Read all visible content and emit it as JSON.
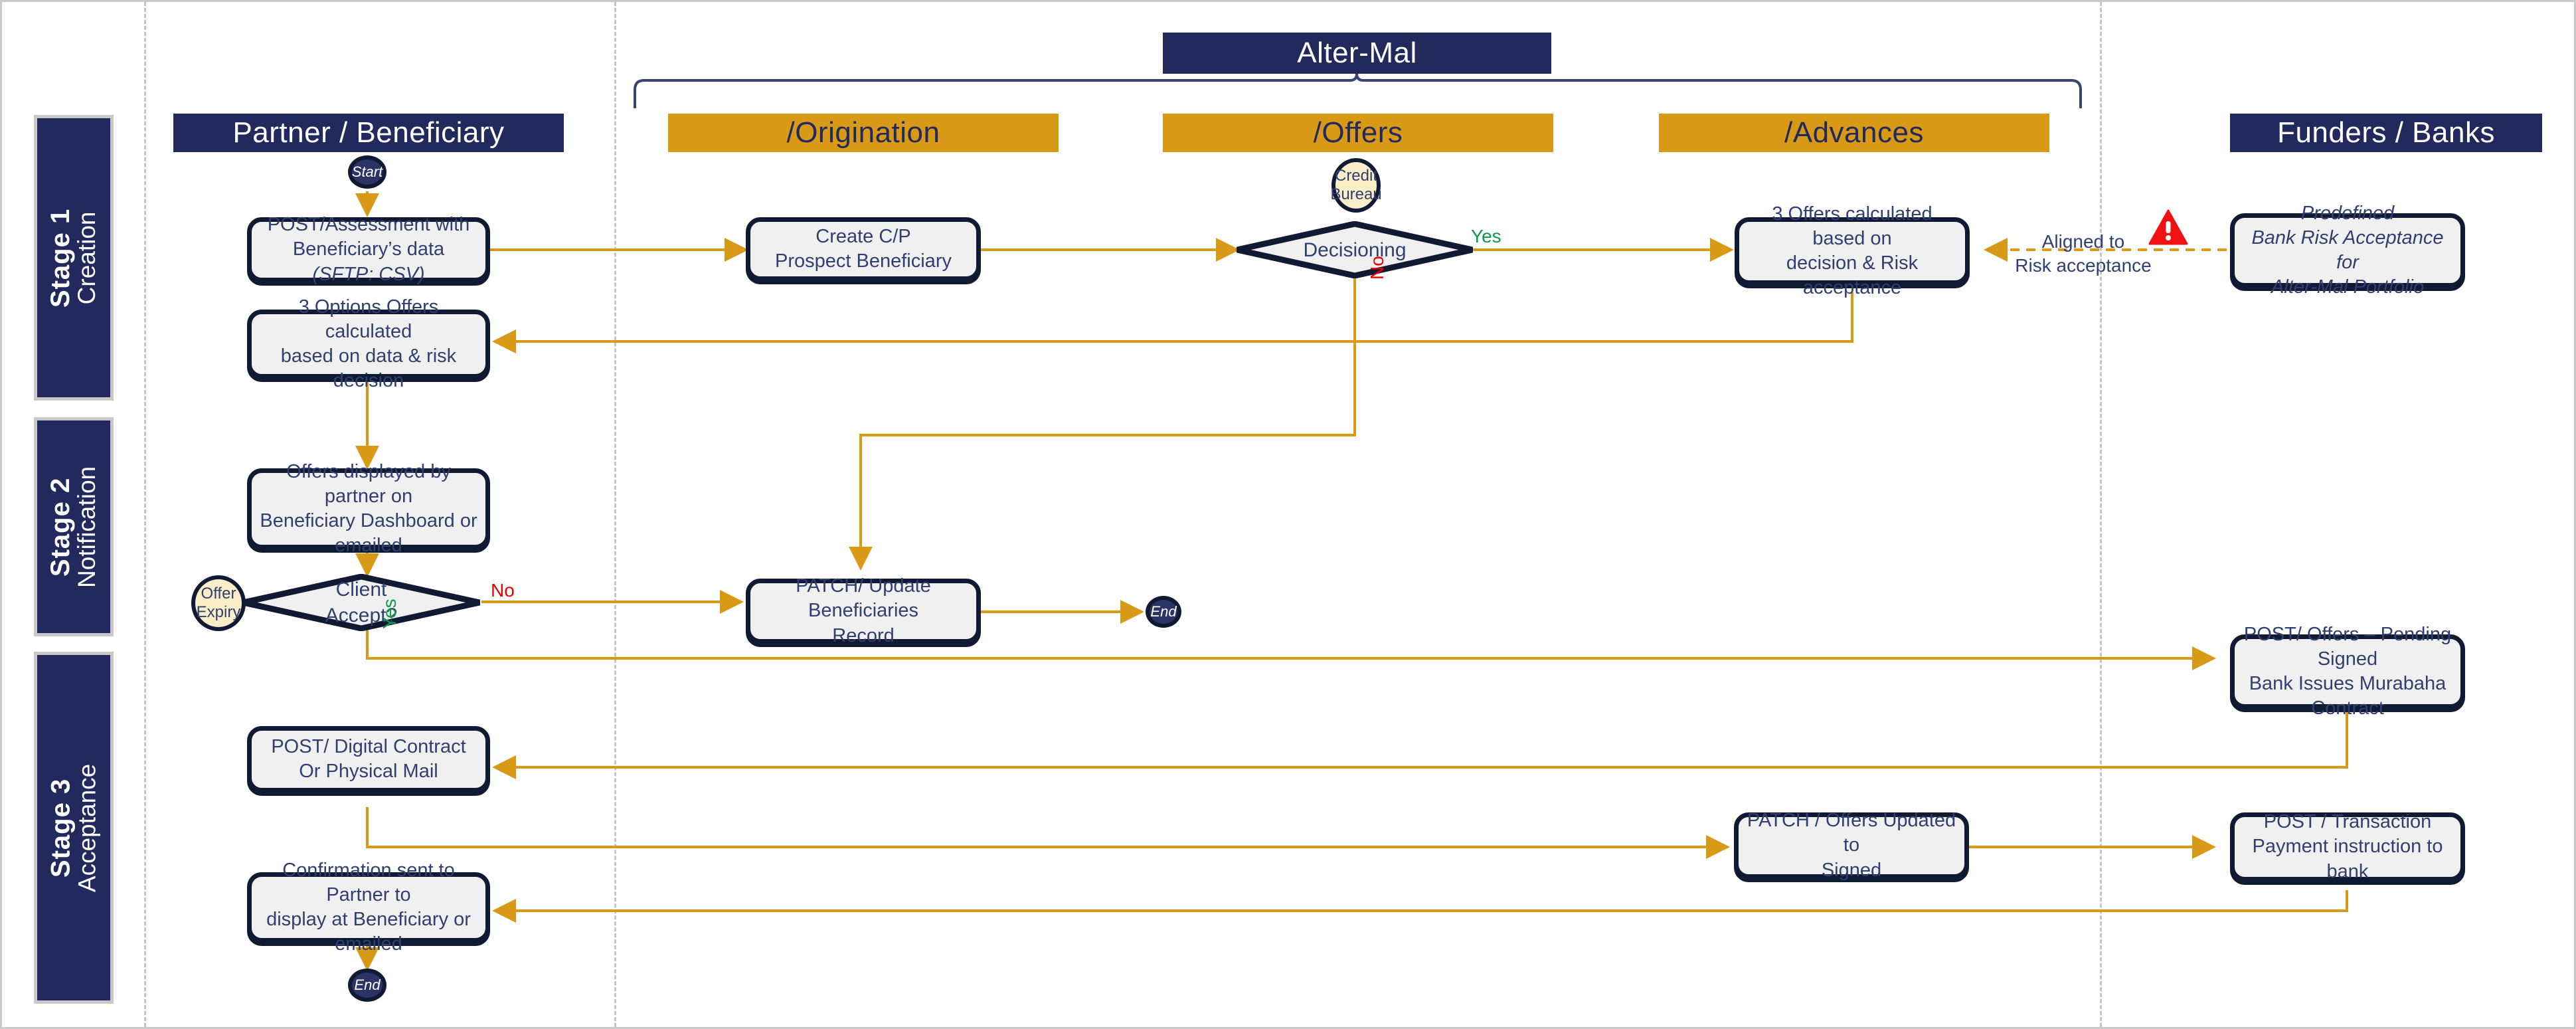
{
  "diagram": {
    "title": "Alter-Mal",
    "stages": [
      {
        "number": "Stage 1",
        "name": "Creation"
      },
      {
        "number": "Stage 2",
        "name": "Notification"
      },
      {
        "number": "Stage 3",
        "name": "Acceptance"
      }
    ],
    "lanes": [
      {
        "id": "partner",
        "label": "Partner / Beneficiary",
        "style": "navy"
      },
      {
        "id": "origination",
        "label": "/Origination",
        "style": "gold"
      },
      {
        "id": "offers",
        "label": "/Offers",
        "style": "gold"
      },
      {
        "id": "advances",
        "label": "/Advances",
        "style": "gold"
      },
      {
        "id": "funders",
        "label": "Funders / Banks",
        "style": "navy"
      }
    ],
    "nodes": {
      "start": "Start",
      "end_mid": "End",
      "end_bottom": "End",
      "post_assessment_l1": "POST/Assessment with",
      "post_assessment_l2": "Beneficiary’s data",
      "post_assessment_l3": "(SFTP: CSV)",
      "three_options_l1": "3 Options Offers calculated",
      "three_options_l2": "based on data & risk decision",
      "offers_displayed_l1": "Offers displayed by partner on",
      "offers_displayed_l2": "Beneficiary Dashboard or",
      "offers_displayed_l3": "emailed",
      "post_digital_contract_l1": "POST/ Digital Contract",
      "post_digital_contract_l2": "Or Physical Mail",
      "confirmation_l1": "Confirmation sent to Partner to",
      "confirmation_l2": "display at Beneficiary or emailed",
      "create_cp_l1": "Create C/P",
      "create_cp_l2": "Prospect Beneficiary",
      "patch_update_l1": "PATCH/ Update Beneficiaries",
      "patch_update_l2": "Record",
      "credit_bureau_l1": "Credit",
      "credit_bureau_l2": "Bureau",
      "decisioning": "Decisioning",
      "three_offers_l1": "3 Offers calculated based on",
      "three_offers_l2": "decision & Risk acceptance",
      "offer_expiry_l1": "Offer",
      "offer_expiry_l2": "Expiry",
      "client_accept_l1": "Client",
      "client_accept_l2": "Accept?",
      "post_offers_pending_l1": "POST/ Offers – Pending Signed",
      "post_offers_pending_l2": "Bank Issues Murabaha Contract",
      "patch_offers_signed_l1": "PATCH / Offers Updated to",
      "patch_offers_signed_l2": "Signed",
      "post_transaction_l1": "POST / Transaction",
      "post_transaction_l2": "Payment instruction to bank",
      "predefined_l1": "Predefined",
      "predefined_l2": "Bank Risk Acceptance for",
      "predefined_l3": "Alter-Mal Portfolio"
    },
    "edge_labels": {
      "decisioning_yes": "Yes",
      "decisioning_no": "No",
      "client_accept_yes": "Yes",
      "client_accept_no": "No",
      "aligned_l1": "Aligned to",
      "aligned_l2": "Risk acceptance"
    },
    "icons": {
      "warning": "warning-triangle-icon"
    },
    "colors": {
      "navy": "#22295c",
      "gold": "#d89a16",
      "edge": "#d89a16",
      "box_border": "#111a33",
      "box_fill": "#f0f0f0",
      "cream": "#faeec8",
      "yes": "#0a9b4b",
      "no": "#ee0000",
      "warning": "#ee1212"
    }
  }
}
